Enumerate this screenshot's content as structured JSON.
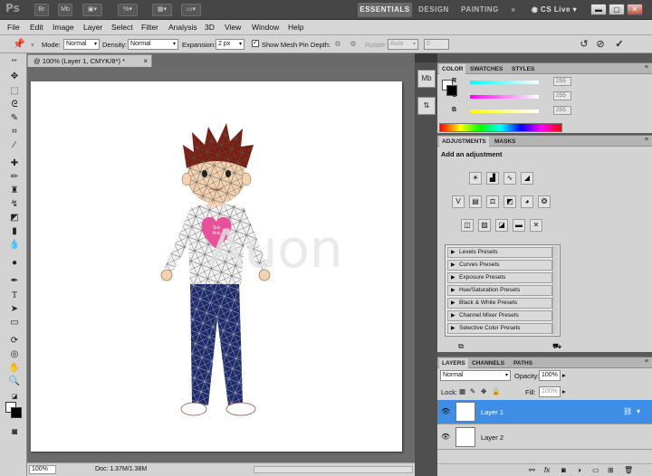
{
  "app": {
    "logo": "Ps"
  },
  "titlebar": {
    "icons": [
      "Br",
      "Mb"
    ],
    "workspaces": [
      "ESSENTIALS",
      "DESIGN",
      "PAINTING"
    ],
    "more": "»",
    "cs_live": "CS Live"
  },
  "menu": [
    "File",
    "Edit",
    "Image",
    "Layer",
    "Select",
    "Filter",
    "Analysis",
    "3D",
    "View",
    "Window",
    "Help"
  ],
  "options": {
    "mode_label": "Mode:",
    "mode_value": "Normal",
    "density_label": "Density:",
    "density_value": "Normal",
    "expansion_label": "Expansion:",
    "expansion_value": "2 px",
    "show_mesh_label": "Show Mesh",
    "pin_depth_label": "Pin Depth:",
    "rotate_label": "Rotate:",
    "rotate_value": "Auto",
    "rotate_angle": "0"
  },
  "document": {
    "tab_title": "@ 100% (Layer 1, CMYK/8*) *",
    "tab_close": "×",
    "zoom": "100%",
    "doc_info": "Doc: 1.37M/1.38M",
    "watermark": "Auon"
  },
  "color_panel": {
    "tabs": [
      "COLOR",
      "SWATCHES",
      "STYLES"
    ],
    "sliders": [
      {
        "label": "R",
        "value": "255",
        "color": "#00d8d8"
      },
      {
        "label": "G",
        "value": "255",
        "color": "#e020e0"
      },
      {
        "label": "B",
        "value": "255",
        "color": "#e8e800"
      }
    ]
  },
  "adjustments_panel": {
    "tabs": [
      "ADJUSTMENTS",
      "MASKS"
    ],
    "title": "Add an adjustment",
    "presets": [
      "Levels Presets",
      "Curves Presets",
      "Exposure Presets",
      "Hue/Saturation Presets",
      "Black & White Presets",
      "Channel Mixer Presets",
      "Selective Color Presets"
    ]
  },
  "layers_panel": {
    "tabs": [
      "LAYERS",
      "CHANNELS",
      "PATHS"
    ],
    "blend_mode": "Normal",
    "opacity_label": "Opacity:",
    "opacity_value": "100%",
    "lock_label": "Lock:",
    "fill_label": "Fill:",
    "fill_value": "100%",
    "layers": [
      {
        "name": "Layer 1",
        "selected": true
      },
      {
        "name": "Layer 2",
        "selected": false
      }
    ],
    "bottom_icons": [
      "link-icon",
      "fx-icon",
      "mask-icon",
      "adjustment-icon",
      "folder-icon",
      "new-layer-icon",
      "trash-icon"
    ]
  },
  "colors": {
    "selection_blue": "#3d8ee4",
    "pants_navy": "#1d2a6b",
    "hair_brown": "#7a1e12",
    "heart_pink": "#e8509a"
  }
}
